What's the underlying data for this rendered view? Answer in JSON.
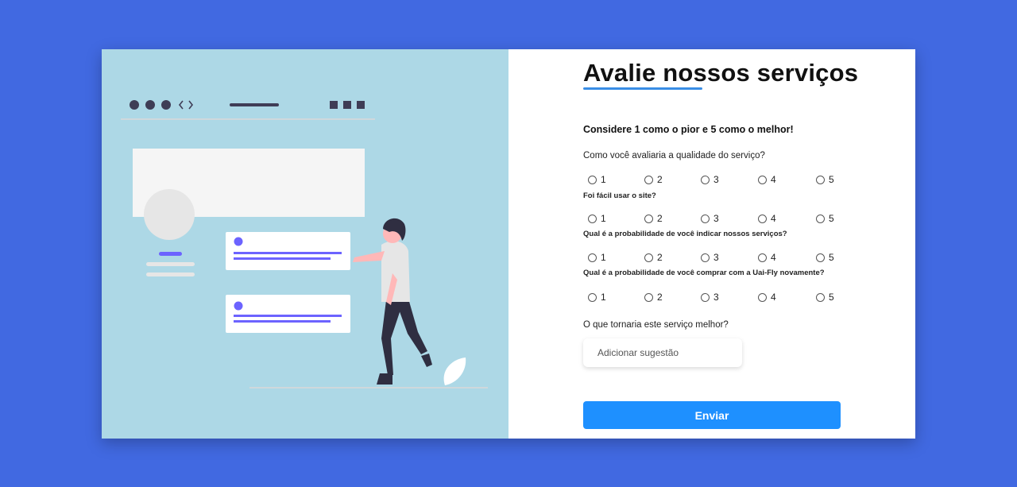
{
  "form": {
    "title": "Avalie nossos serviços",
    "intro": "Considere 1 como o pior e 5 como o melhor!",
    "questions": [
      {
        "label": "Como você avaliaria a qualidade do serviço?"
      },
      {
        "label": "Foi fácil usar o site?"
      },
      {
        "label": "Qual é a probabilidade de você indicar nossos serviços?"
      },
      {
        "label": "Qual é a probabilidade de você comprar com a Uai-Fly novamente?"
      }
    ],
    "options": [
      "1",
      "2",
      "3",
      "4",
      "5"
    ],
    "suggestion_label": "O que tornaria este serviço melhor?",
    "suggestion_placeholder": "Adicionar sugestão",
    "submit_label": "Enviar"
  },
  "colors": {
    "page_background": "#4169e1",
    "illustration_background": "#add8e6",
    "accent": "#1e90ff",
    "title_underline": "#3a8ee6",
    "illustration_accent": "#6c63ff"
  }
}
